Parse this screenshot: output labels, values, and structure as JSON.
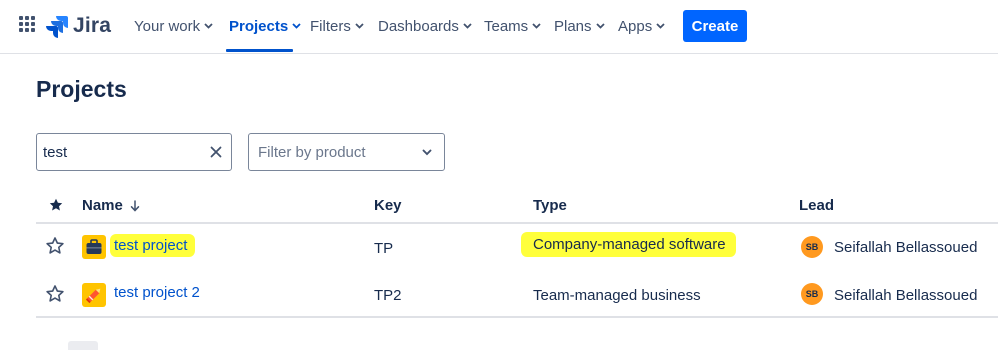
{
  "nav": {
    "app_name": "Jira",
    "items": [
      {
        "label": "Your work",
        "active": false
      },
      {
        "label": "Projects",
        "active": true
      },
      {
        "label": "Filters",
        "active": false
      },
      {
        "label": "Dashboards",
        "active": false
      },
      {
        "label": "Teams",
        "active": false
      },
      {
        "label": "Plans",
        "active": false
      },
      {
        "label": "Apps",
        "active": false
      }
    ],
    "create_label": "Create",
    "icons": {
      "apps": "apps-grid-icon",
      "logo": "jira-logo-icon",
      "chevron": "chevron-down-icon"
    },
    "accent_color": "#0052cc",
    "create_color": "#0065ff"
  },
  "page": {
    "title": "Projects"
  },
  "search": {
    "value": "test",
    "clear_icon": "close-icon"
  },
  "filter": {
    "placeholder": "Filter by product",
    "icon": "chevron-down-icon"
  },
  "table": {
    "columns": {
      "star_icon": "star-filled-icon",
      "name": "Name",
      "sort_icon": "arrow-down-icon",
      "key": "Key",
      "type": "Type",
      "lead": "Lead"
    },
    "rows": [
      {
        "starred": false,
        "name": "test project",
        "key": "TP",
        "type": "Company-managed software",
        "lead_initials": "SB",
        "lead": "Seifallah Bellassoued",
        "avatar_icon": "briefcase-icon"
      },
      {
        "starred": false,
        "name": "test project 2",
        "key": "TP2",
        "type": "Team-managed business",
        "lead_initials": "SB",
        "lead": "Seifallah Bellassoued",
        "avatar_icon": "pencil-icon"
      }
    ],
    "highlight_color": "#ffff3b"
  }
}
